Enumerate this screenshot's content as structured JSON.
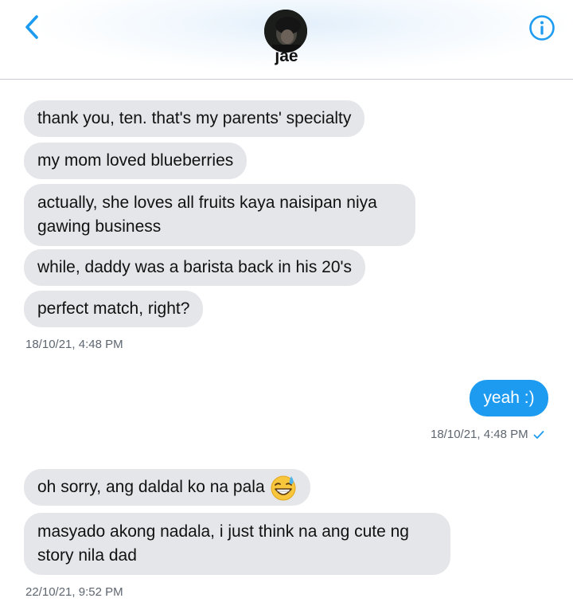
{
  "header": {
    "contact_name": "jae",
    "back_icon": "chevron-left-icon",
    "info_icon": "info-icon",
    "accent_color": "#1d9bf0"
  },
  "messages": [
    {
      "text": "thank you, ten. that's my parents' specialty",
      "direction": "incoming"
    },
    {
      "text": "my mom loved blueberries",
      "direction": "incoming"
    },
    {
      "text_line1": "actually, she loves all fruits kaya naisipan niya",
      "text_line2": "gawing business",
      "direction": "incoming"
    },
    {
      "text": "while, daddy was a barista back in his 20's",
      "direction": "incoming"
    },
    {
      "text": "perfect match, right?",
      "direction": "incoming"
    },
    {
      "text": "yeah :)",
      "direction": "outgoing"
    },
    {
      "text": "oh sorry, ang daldal ko na pala",
      "emoji": "grinning-sweat-emoji",
      "direction": "incoming"
    },
    {
      "text_line1": "masyado akong nadala, i just think na ang cute ng",
      "text_line2": "story nila dad",
      "direction": "incoming"
    }
  ],
  "timestamps": {
    "first": "18/10/21, 4:48 PM",
    "second": "18/10/21, 4:48 PM",
    "third": "22/10/21, 9:52 PM"
  },
  "colors": {
    "incoming_bubble": "#e5e6ea",
    "outgoing_bubble": "#1d9bf0",
    "timestamp_text": "#5e6670"
  }
}
